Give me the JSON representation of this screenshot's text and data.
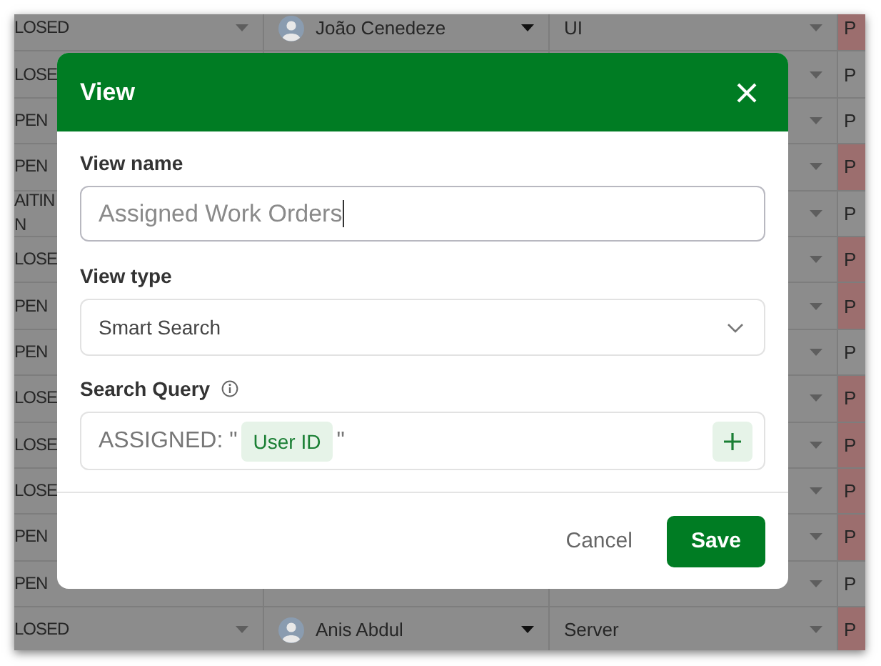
{
  "table": {
    "rows": [
      {
        "status": "LOSED",
        "assignee": {
          "name": "João Cenedeze"
        },
        "category": "UI",
        "priority": "P",
        "color": "#9c6e6e"
      },
      {
        "status": "LOSE",
        "priority": "P",
        "color": "#8e8e8e"
      },
      {
        "status": "PEN",
        "priority": "P",
        "color": "#8e8e8e"
      },
      {
        "status": "PEN",
        "priority": "P",
        "color": "#9c6e6e"
      },
      {
        "status": "AITIN\nN",
        "priority": "P",
        "color": "#8e8e8e"
      },
      {
        "status": "LOSE",
        "priority": "P",
        "color": "#9c6e6e"
      },
      {
        "status": "PEN",
        "priority": "P",
        "color": "#9c6e6e"
      },
      {
        "status": "PEN",
        "priority": "P",
        "color": "#8e8e8e"
      },
      {
        "status": "LOSE",
        "priority": "P",
        "color": "#9c6e6e"
      },
      {
        "status": "LOSE",
        "priority": "P",
        "color": "#9c6e6e"
      },
      {
        "status": "LOSE",
        "priority": "P",
        "color": "#9c6e6e"
      },
      {
        "status": "PEN",
        "priority": "P",
        "color": "#9c6e6e"
      },
      {
        "status": "PEN",
        "priority": "P",
        "color": "#8e8e8e"
      },
      {
        "status": "LOSED",
        "assignee": {
          "name": "Anis Abdul"
        },
        "category": "Server",
        "priority": "P",
        "color": "#9c6e6e"
      }
    ]
  },
  "dialog": {
    "title": "View",
    "view_name": {
      "label": "View name",
      "value": "Assigned Work Orders"
    },
    "view_type": {
      "label": "View type",
      "value": "Smart Search"
    },
    "search_query": {
      "label": "Search Query",
      "parts": [
        {
          "kind": "text",
          "text": "ASSIGNED: \""
        },
        {
          "kind": "token",
          "text": "User ID"
        },
        {
          "kind": "text",
          "text": "\""
        }
      ]
    },
    "buttons": [
      {
        "kind": "secondary",
        "label": "Cancel"
      },
      {
        "kind": "primary",
        "label": "Save"
      }
    ]
  }
}
